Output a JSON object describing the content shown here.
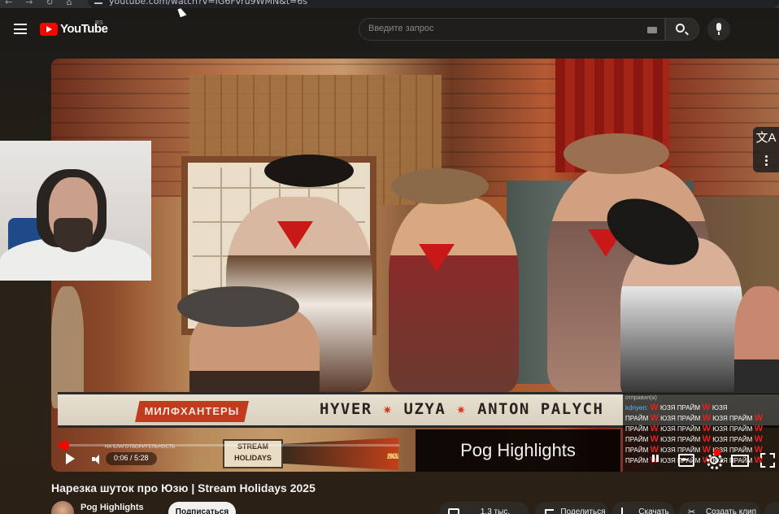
{
  "browser": {
    "url": "youtube.com/watch?v=IG6Fvru9WMN&t=6s"
  },
  "header": {
    "logo_text": "YouTube",
    "region": "RS",
    "search_placeholder": "Введите запрос"
  },
  "video": {
    "banner_tag": "МИЛФХАНТЕРЫ",
    "banner_names": [
      "HYVER",
      "UZYA",
      "ANTON PALYCH"
    ],
    "stream_logo_lines": [
      "STREAM",
      "HOLIDAYS"
    ],
    "gold_logo_lines": [
      "ЗОЛОТАЯ",
      "ЛИХОРАДКА"
    ],
    "charity_text": "НА БЛАГОТВОРИТЕЛЬНОСТЬ",
    "caption": "Pog Highlights",
    "time": "0:06 / 5:28",
    "progress_fraction": 0.019,
    "chat": {
      "header": "отправил(а)",
      "nick": "kdnyen:",
      "repeat_word": "ЮЗЯ",
      "repeat_word2": "ПРАЙМ",
      "emote": "W"
    },
    "translate_glyph": "文A"
  },
  "meta": {
    "title": "Нарезка шуток про Юзю | Stream Holidays 2025",
    "channel": "Pog Highlights",
    "subscribe": "Подписаться",
    "likes": "1,3 тыс.",
    "share": "Поделиться",
    "download": "Скачать",
    "clip": "Создать клип"
  },
  "colors": {
    "accent": "#ff0000",
    "bandana": "#c81818"
  }
}
